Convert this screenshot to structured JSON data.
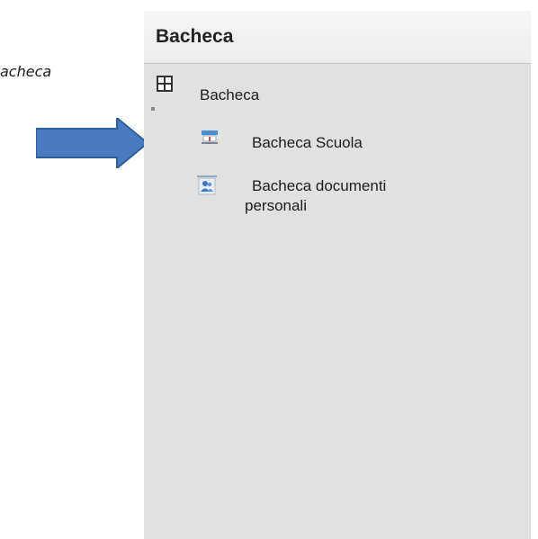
{
  "caption": "acheca",
  "panel": {
    "title": "Bacheca"
  },
  "tree": {
    "root": {
      "label": "Bacheca",
      "icon": "grid-icon"
    },
    "items": [
      {
        "label": "Bacheca Scuola",
        "icon": "school-board-icon"
      },
      {
        "label_line1": "Bacheca documenti",
        "label_line2": "personali",
        "icon": "personal-documents-icon"
      }
    ]
  },
  "colors": {
    "arrow": "#4a7bc0",
    "arrow_border": "#2f5f99",
    "panel_bg": "#e1e1e1",
    "header_bg": "#f0f0f0"
  }
}
